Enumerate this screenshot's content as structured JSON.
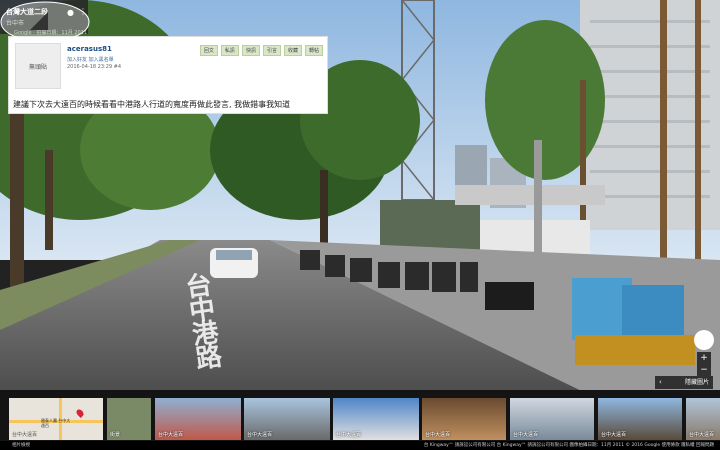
{
  "location_card": {
    "title": "台灣大道二段",
    "subtitle": "台中市",
    "date": "Google · 拍攝日期：11月 2011"
  },
  "post": {
    "avatar_label": "無頭貼",
    "username": "acerasus81",
    "friend_links": "加入好友  加入黑名單",
    "post_date": "2016-04-18 23:29  #4",
    "actions": [
      "回文",
      "私訊",
      "快訊",
      "引言",
      "收藏",
      "轉帖"
    ],
    "body": "建議下次去大遠百的時候看看中港路人行道的寬度再做此發言, 我做錯事我知道"
  },
  "road_text": "台中港路",
  "controls": {
    "zoom_in": "+",
    "zoom_out": "−",
    "photos_toggle": "隱藏圖片",
    "chevron": "‹"
  },
  "thumbnails": [
    {
      "caption": "台中大遠百"
    },
    {
      "caption": "街景"
    },
    {
      "caption": "台中大遠百"
    },
    {
      "caption": "台中大遠百"
    },
    {
      "caption": "台中大遠百"
    },
    {
      "caption": "台中大遠百"
    },
    {
      "caption": "台中大遠百"
    },
    {
      "caption": "台中大遠百"
    },
    {
      "caption": "台中大遠百"
    }
  ],
  "map_thumb_text": "國泰人壽 台中大遠百",
  "footer": {
    "left": "相片檢視",
    "right": "台 Kingway™ 請訴訟公司有限公司  台 Kingway™ 請訴訟公司有限公司  圖像拍攝日期：11月 2011  © 2016 Google  使用條款  隱私權  回報問題"
  }
}
